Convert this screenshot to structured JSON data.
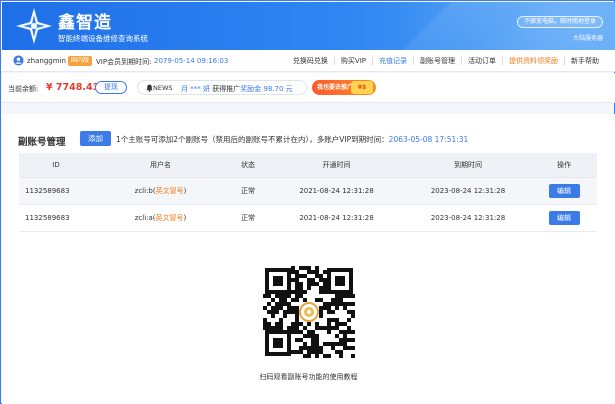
{
  "header": {
    "title": "鑫智造",
    "subtitle": "智能终端设备维修查询系统",
    "slogan": "不挪变电脑，随时随地登录",
    "server": "大陆服务器"
  },
  "user": {
    "name": "zhanggmin",
    "region_badge": "国内版",
    "vip_label": "VIP会员到期时间:",
    "vip_expiry": "2079-05-14 09:16:03"
  },
  "top_nav": [
    {
      "label": "兑换码兑换",
      "style": "normal"
    },
    {
      "label": "购买VIP",
      "style": "normal"
    },
    {
      "label": "充值记录",
      "style": "blue"
    },
    {
      "label": "副账号管理",
      "style": "normal"
    },
    {
      "label": "活动订单",
      "style": "normal"
    },
    {
      "label": "提供资料领奖励",
      "style": "orange"
    },
    {
      "label": "新手帮助",
      "style": "normal"
    }
  ],
  "balance": {
    "label": "当前余额:",
    "value": "¥ 7748.43",
    "withdraw_label": "提现"
  },
  "news": {
    "tag": "NEWS",
    "user": "月 *** 妍",
    "text": "获得推广",
    "reward": "奖励金 98.70 元"
  },
  "promo": {
    "label": "我也要去推广",
    "coin_text": "¥$"
  },
  "section": {
    "title": "副账号管理",
    "add_label": "添加",
    "note": "1个主账号可添加2个副账号（禁用后的副账号不累计在内），多账户VIP到期时间：",
    "note_date": "2063-05-08 17:51:31"
  },
  "table": {
    "columns": [
      "ID",
      "用户名",
      "状态",
      "开通时间",
      "到期时间",
      "操作"
    ],
    "rows": [
      {
        "id": "1132589683",
        "user_prefix": "zcli:b(",
        "user_en": "英文冒号",
        "user_suffix": ")",
        "status": "正常",
        "open_time": "2021-08-24 12:31:28",
        "expire_time": "2023-08-24 12:31:28",
        "action": "编辑"
      },
      {
        "id": "1132589683",
        "user_prefix": "zcli:a(",
        "user_en": "英文冒号",
        "user_suffix": ")",
        "status": "正常",
        "open_time": "2021-08-24 12:31:28",
        "expire_time": "2023-08-24 12:31:28",
        "action": "编辑"
      }
    ]
  },
  "qr": {
    "caption": "扫码观看副账号功能的使用教程",
    "icon": "qr-code-icon"
  },
  "colors": {
    "primary": "#3a7be8",
    "header_start": "#1f6fe8",
    "header_end": "#5aa8f7",
    "balance": "#e33d2f",
    "accent_orange": "#f07a18"
  }
}
